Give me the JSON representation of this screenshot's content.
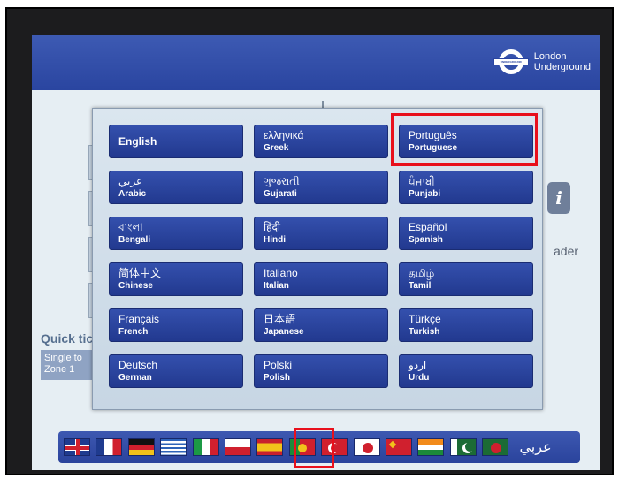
{
  "brand": {
    "line1": "London",
    "line2": "Underground",
    "logo_icon": "roundel-icon",
    "logo_text": "UNDERGROUND"
  },
  "background": {
    "quick_tickets_label": "Quick tic",
    "single_ticket_line1": "Single to",
    "single_ticket_line2": "Zone 1",
    "reader_text": "ader",
    "info_icon": "info-icon",
    "info_glyph": "i"
  },
  "languages": [
    {
      "native": "English",
      "english": ""
    },
    {
      "native": "ελληνικά",
      "english": "Greek"
    },
    {
      "native": "Português",
      "english": "Portuguese"
    },
    {
      "native": "عربي",
      "english": "Arabic"
    },
    {
      "native": "ગુજરાતી",
      "english": "Gujarati"
    },
    {
      "native": "ਪੰਜਾਬੀ",
      "english": "Punjabi"
    },
    {
      "native": "বাংলা",
      "english": "Bengali"
    },
    {
      "native": "हिंदी",
      "english": "Hindi"
    },
    {
      "native": "Español",
      "english": "Spanish"
    },
    {
      "native": "简体中文",
      "english": "Chinese"
    },
    {
      "native": "Italiano",
      "english": "Italian"
    },
    {
      "native": "தமிழ்",
      "english": "Tamil"
    },
    {
      "native": "Français",
      "english": "French"
    },
    {
      "native": "日本語",
      "english": "Japanese"
    },
    {
      "native": "Türkçe",
      "english": "Turkish"
    },
    {
      "native": "Deutsch",
      "english": "German"
    },
    {
      "native": "Polski",
      "english": "Polish"
    },
    {
      "native": "اردو",
      "english": "Urdu"
    }
  ],
  "flags": [
    {
      "name": "uk-flag-icon",
      "colors": [
        "#1f3b8f",
        "#ffffff",
        "#d0202e"
      ]
    },
    {
      "name": "france-flag-icon",
      "colors": [
        "#1f3b8f",
        "#ffffff",
        "#d0202e"
      ]
    },
    {
      "name": "germany-flag-icon",
      "colors": [
        "#111111",
        "#d0202e",
        "#f2c21b"
      ]
    },
    {
      "name": "greece-flag-icon",
      "colors": [
        "#2e63b8",
        "#ffffff"
      ]
    },
    {
      "name": "italy-flag-icon",
      "colors": [
        "#1c9a45",
        "#ffffff",
        "#d0202e"
      ]
    },
    {
      "name": "poland-flag-icon",
      "colors": [
        "#ffffff",
        "#d0202e"
      ]
    },
    {
      "name": "spain-flag-icon",
      "colors": [
        "#c8202e",
        "#f2c21b"
      ]
    },
    {
      "name": "portugal-flag-icon",
      "colors": [
        "#1c8a3a",
        "#d0202e",
        "#f2c21b"
      ]
    },
    {
      "name": "turkey-flag-icon",
      "colors": [
        "#d0202e",
        "#ffffff"
      ]
    },
    {
      "name": "japan-flag-icon",
      "colors": [
        "#ffffff",
        "#d0202e"
      ]
    },
    {
      "name": "china-flag-icon",
      "colors": [
        "#d0202e",
        "#f2c21b"
      ]
    },
    {
      "name": "india-flag-icon",
      "colors": [
        "#f28b1b",
        "#ffffff",
        "#1c8a3a"
      ]
    },
    {
      "name": "pakistan-flag-icon",
      "colors": [
        "#ffffff",
        "#1c6b35"
      ]
    },
    {
      "name": "bangladesh-flag-icon",
      "colors": [
        "#1c6b35",
        "#d0202e"
      ]
    }
  ],
  "flag_strip_text": "عربي",
  "highlight_color": "#e8101c"
}
